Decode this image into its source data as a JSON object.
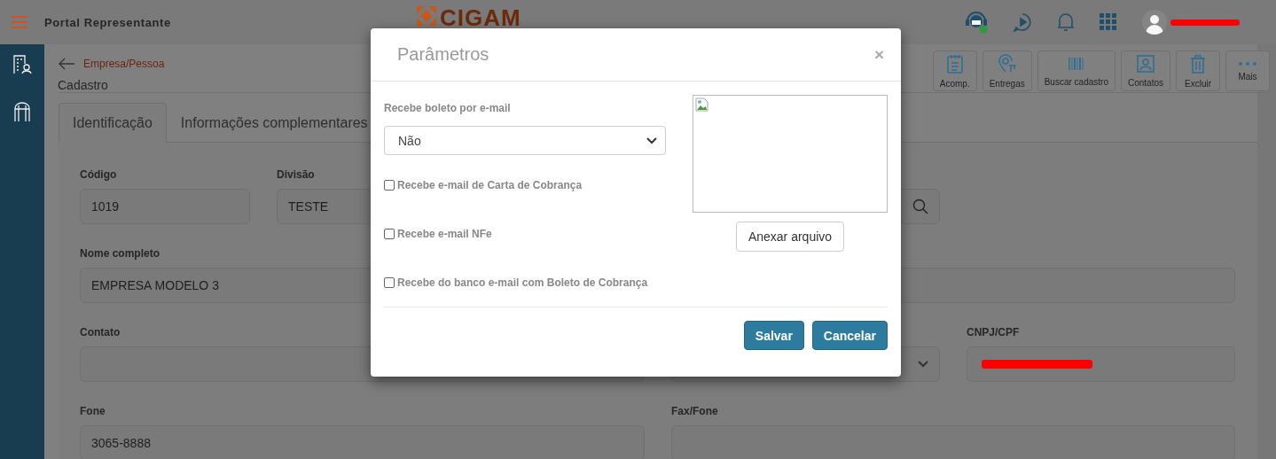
{
  "top_bar": {
    "title": "Portal Representante",
    "logo": {
      "name": "CIGAM"
    },
    "user": {
      "redacted": true
    }
  },
  "header": {
    "breadcrumb": "Empresa/Pessoa",
    "subtitle": "Cadastro"
  },
  "toolbar": [
    {
      "label": "Acomp."
    },
    {
      "label": "Entregas"
    },
    {
      "label": "Buscar cadastro"
    },
    {
      "label": "Contatos"
    },
    {
      "label": "Excluir"
    },
    {
      "label": "Mais"
    }
  ],
  "tabs": [
    {
      "label": "Identificação",
      "selected": true
    },
    {
      "label": "Informações complementares",
      "selected": false
    }
  ],
  "form": {
    "rows": [
      [
        {
          "kind": "text",
          "label": "Código",
          "value": "1019"
        },
        {
          "kind": "text",
          "label": "Divisão",
          "value": "TESTE"
        },
        {
          "kind": "search"
        }
      ],
      [
        {
          "kind": "text",
          "label": "Nome completo",
          "value": "EMPRESA MODELO 3"
        },
        {
          "kind": "text"
        }
      ],
      [
        {
          "kind": "text",
          "label": "Contato"
        },
        {
          "kind": "select"
        },
        {
          "kind": "text",
          "label": "CNPJ/CPF",
          "redacted": true
        }
      ],
      [
        {
          "kind": "text",
          "label": "Fone",
          "value": "3065-8888"
        },
        {
          "kind": "text",
          "label": "Fax/Fone"
        }
      ]
    ]
  },
  "modal": {
    "title": "Parâmetros",
    "close": "×",
    "select": {
      "label": "Recebe boleto por e-mail",
      "value": "Não"
    },
    "checkboxes": [
      {
        "label": "Recebe e-mail de Carta de Cobrança",
        "checked": false
      },
      {
        "label": "Recebe e-mail NFe",
        "checked": false
      },
      {
        "label": "Recebe do banco e-mail com Boleto de Cobrança",
        "checked": false
      }
    ],
    "attach_button": "Anexar arquivo",
    "buttons": [
      {
        "label": "Salvar"
      },
      {
        "label": "Cancelar"
      }
    ]
  }
}
